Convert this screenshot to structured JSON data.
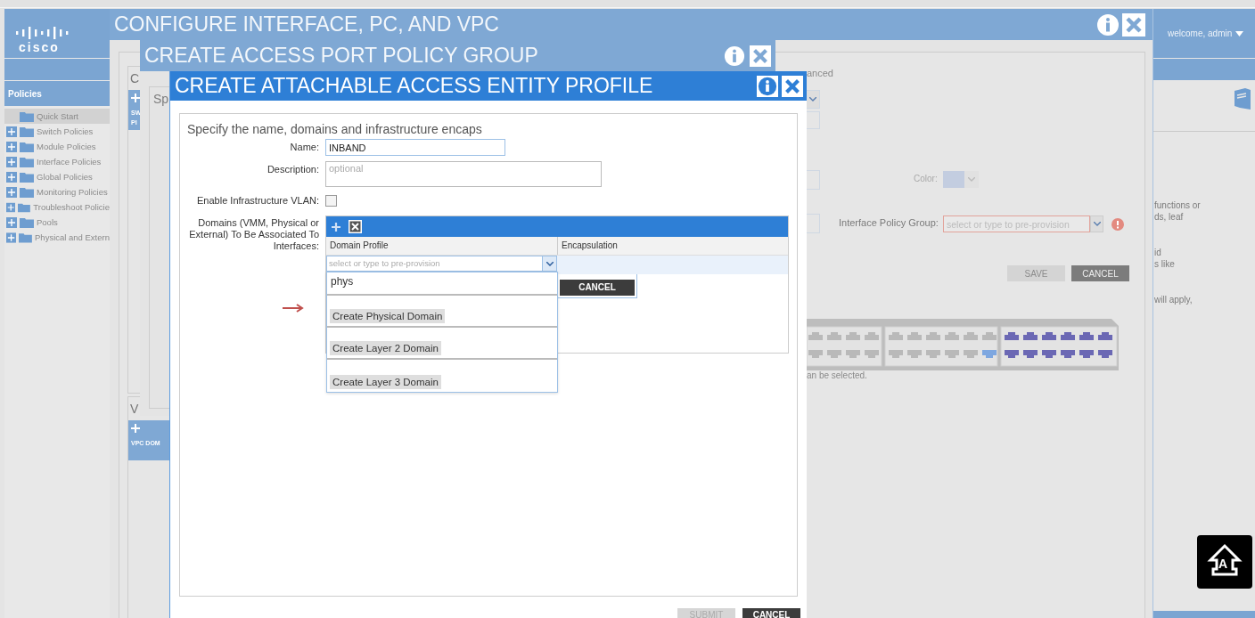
{
  "app": {
    "logo": "cisco",
    "user": "welcome, admin",
    "sidebar": {
      "title": "Policies",
      "items": [
        {
          "label": "Quick Start",
          "expandable": false,
          "selected": true
        },
        {
          "label": "Switch Policies",
          "expandable": true,
          "selected": false
        },
        {
          "label": "Module Policies",
          "expandable": true,
          "selected": false
        },
        {
          "label": "Interface Policies",
          "expandable": true,
          "selected": false
        },
        {
          "label": "Global Policies",
          "expandable": true,
          "selected": false
        },
        {
          "label": "Monitoring Policies",
          "expandable": true,
          "selected": false
        },
        {
          "label": "Troubleshoot Policie",
          "expandable": true,
          "selected": false
        },
        {
          "label": "Pools",
          "expandable": true,
          "selected": false
        },
        {
          "label": "Physical and Extern",
          "expandable": true,
          "selected": false
        }
      ]
    },
    "help_fragments": [
      {
        "lines": [
          "functions or",
          "ds, leaf"
        ]
      },
      {
        "lines": [
          "id",
          "s like"
        ]
      },
      {
        "lines": [
          "will apply,"
        ]
      }
    ],
    "floating_button": "A"
  },
  "configure_window": {
    "title": "CONFIGURE INTERFACE, PC, AND VPC",
    "panels": [
      {
        "heading": "C",
        "labels": [
          "SW",
          "PI"
        ]
      },
      {
        "heading": "V",
        "labels": [
          "VPC DOM"
        ]
      }
    ],
    "advanced_fragment": "anced",
    "color_label": "Color:",
    "policy_group": {
      "label": "Interface Policy Group:",
      "placeholder": "select or type to pre-provision",
      "error": true
    },
    "buttons": [
      {
        "label": "SAVE",
        "disabled": true
      },
      {
        "label": "CANCEL",
        "disabled": false
      }
    ],
    "ports_note": "an be selected."
  },
  "policy_group_window": {
    "title": "CREATE ACCESS PORT POLICY GROUP",
    "intro_fragment": "Sp"
  },
  "aep_window": {
    "title": "CREATE ATTACHABLE ACCESS ENTITY PROFILE",
    "intro": "Specify the name, domains and infrastructure encaps",
    "name": {
      "label": "Name:",
      "value": "INBAND"
    },
    "description": {
      "label": "Description:",
      "placeholder": "optional"
    },
    "infra_vlan": {
      "label": "Enable Infrastructure VLAN:",
      "checked": false
    },
    "domains": {
      "label": "Domains (VMM, Physical or External) To Be Associated To Interfaces:",
      "columns": [
        "Domain Profile",
        "Encapsulation"
      ],
      "combo_placeholder": "select or type to pre-provision",
      "typed": "phys",
      "options": [
        "Create Physical Domain",
        "Create Layer 2 Domain",
        "Create Layer 3 Domain"
      ],
      "row_button": "CANCEL"
    },
    "buttons": [
      {
        "label": "SUBMIT",
        "disabled": true
      },
      {
        "label": "CANCEL",
        "disabled": false
      }
    ]
  }
}
